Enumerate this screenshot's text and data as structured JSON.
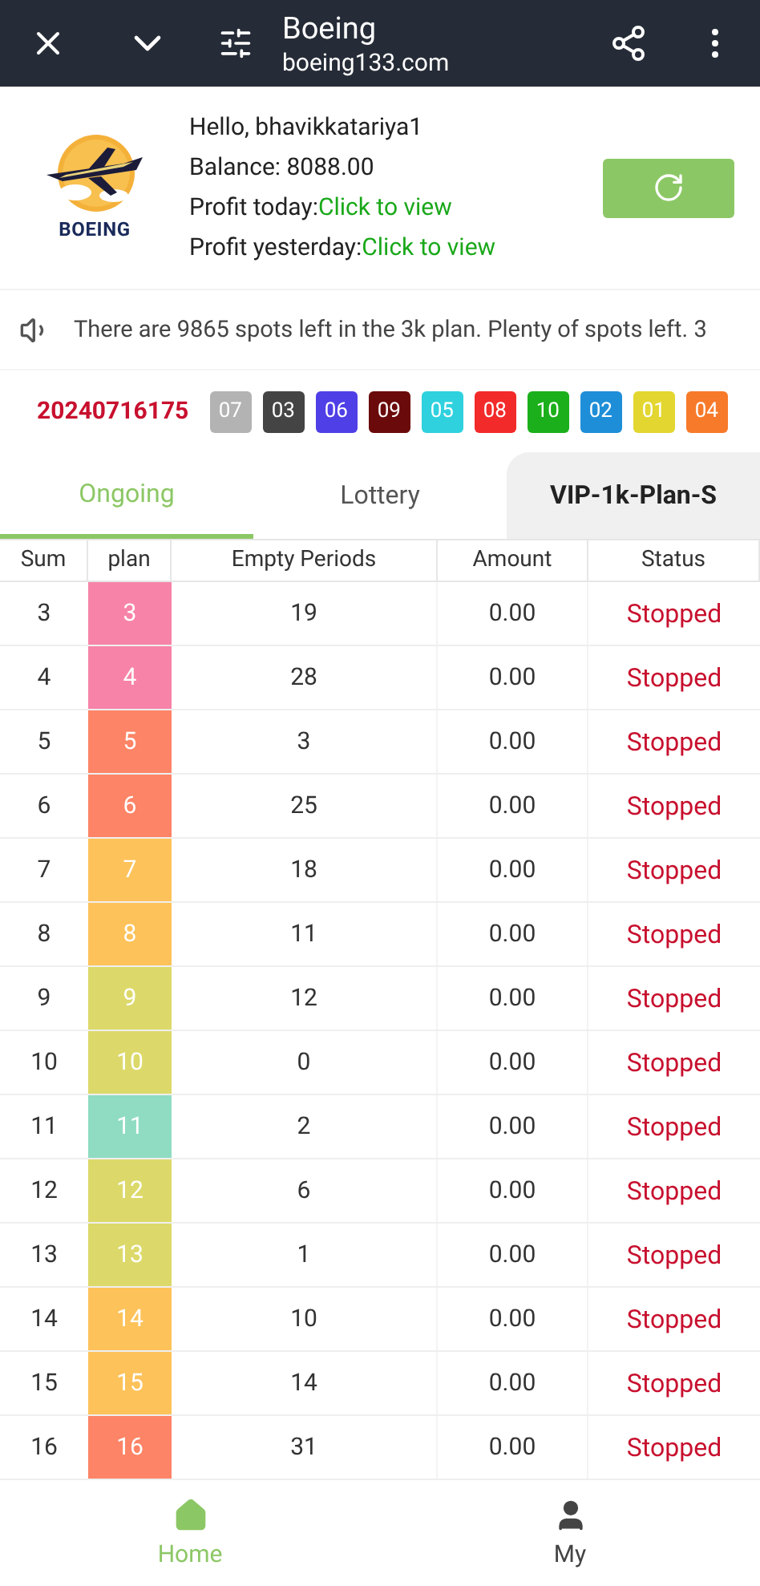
{
  "browser_bar": {
    "title": "Boeing",
    "url": "boeing133.com"
  },
  "profile": {
    "logo_text": "BOEING",
    "greeting": "Hello, bhavikkatariya1",
    "balance": "Balance: 8088.00",
    "profit_today": {
      "label": "Profit today:",
      "link": "Click to view"
    },
    "profit_yesterday": {
      "label": "Profit yesterday:",
      "link": "Click to view"
    }
  },
  "notice": "There are 9865 spots left in the 3k plan. Plenty of spots left. 3",
  "draw": {
    "period": "20240716175",
    "balls": [
      {
        "number": "07",
        "color": "#b3b3b3"
      },
      {
        "number": "03",
        "color": "#444444"
      },
      {
        "number": "06",
        "color": "#4f3fe6"
      },
      {
        "number": "09",
        "color": "#6b0a0a"
      },
      {
        "number": "05",
        "color": "#2fd1de"
      },
      {
        "number": "08",
        "color": "#f22a2a"
      },
      {
        "number": "10",
        "color": "#1bb01b"
      },
      {
        "number": "02",
        "color": "#1f8ed8"
      },
      {
        "number": "01",
        "color": "#e3d630"
      },
      {
        "number": "04",
        "color": "#f77a2a"
      }
    ]
  },
  "tabs": [
    {
      "label": "Ongoing",
      "selected": true,
      "kind": "tab"
    },
    {
      "label": "Lottery",
      "selected": false,
      "kind": "tab"
    },
    {
      "label": "VIP-1k-Plan-S",
      "selected": false,
      "kind": "plan"
    }
  ],
  "table": {
    "columns": [
      "Sum",
      "plan",
      "Empty Periods",
      "Amount",
      "Status"
    ],
    "rows": [
      {
        "sum": "3",
        "plan": "3",
        "color": "#f783a8",
        "empty": "19",
        "amount": "0.00",
        "status": "Stopped"
      },
      {
        "sum": "4",
        "plan": "4",
        "color": "#f783a8",
        "empty": "28",
        "amount": "0.00",
        "status": "Stopped"
      },
      {
        "sum": "5",
        "plan": "5",
        "color": "#fd8466",
        "empty": "3",
        "amount": "0.00",
        "status": "Stopped"
      },
      {
        "sum": "6",
        "plan": "6",
        "color": "#fd8466",
        "empty": "25",
        "amount": "0.00",
        "status": "Stopped"
      },
      {
        "sum": "7",
        "plan": "7",
        "color": "#fdc25a",
        "empty": "18",
        "amount": "0.00",
        "status": "Stopped"
      },
      {
        "sum": "8",
        "plan": "8",
        "color": "#fdc25a",
        "empty": "11",
        "amount": "0.00",
        "status": "Stopped"
      },
      {
        "sum": "9",
        "plan": "9",
        "color": "#dcd96a",
        "empty": "12",
        "amount": "0.00",
        "status": "Stopped"
      },
      {
        "sum": "10",
        "plan": "10",
        "color": "#dcd96a",
        "empty": "0",
        "amount": "0.00",
        "status": "Stopped"
      },
      {
        "sum": "11",
        "plan": "11",
        "color": "#8fdcc2",
        "empty": "2",
        "amount": "0.00",
        "status": "Stopped"
      },
      {
        "sum": "12",
        "plan": "12",
        "color": "#dcd96a",
        "empty": "6",
        "amount": "0.00",
        "status": "Stopped"
      },
      {
        "sum": "13",
        "plan": "13",
        "color": "#dcd96a",
        "empty": "1",
        "amount": "0.00",
        "status": "Stopped"
      },
      {
        "sum": "14",
        "plan": "14",
        "color": "#fdc25a",
        "empty": "10",
        "amount": "0.00",
        "status": "Stopped"
      },
      {
        "sum": "15",
        "plan": "15",
        "color": "#fdc25a",
        "empty": "14",
        "amount": "0.00",
        "status": "Stopped"
      },
      {
        "sum": "16",
        "plan": "16",
        "color": "#fd8466",
        "empty": "31",
        "amount": "0.00",
        "status": "Stopped"
      }
    ]
  },
  "bottom_nav": [
    {
      "label": "Home",
      "selected": true,
      "kind": "home"
    },
    {
      "label": "My",
      "selected": false,
      "kind": "my"
    }
  ]
}
